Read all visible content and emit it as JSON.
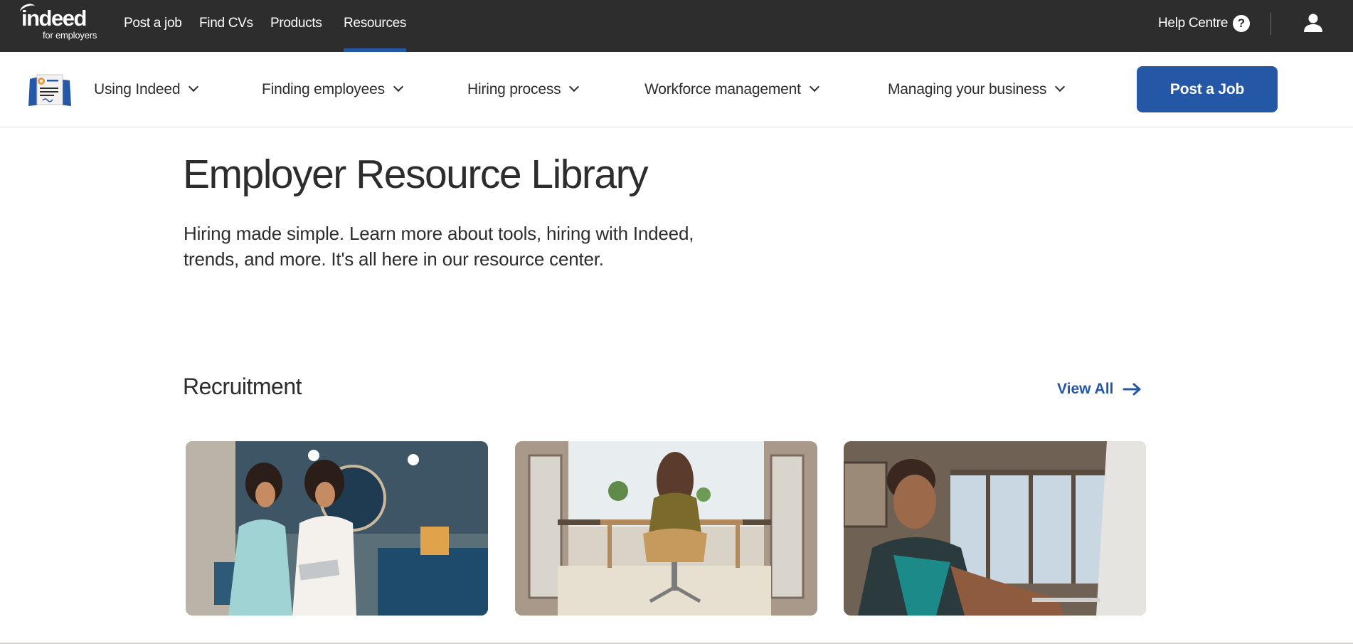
{
  "topbar": {
    "logo_word": "indeed",
    "logo_sub": "for employers",
    "nav": [
      "Post a job",
      "Find CVs",
      "Products",
      "Resources"
    ],
    "active_nav": "Resources",
    "help_label": "Help Centre",
    "help_icon": "question-icon",
    "user_icon": "person-icon"
  },
  "subnav": {
    "logo_icon": "document-illustration-icon",
    "items": [
      "Using Indeed",
      "Finding employees",
      "Hiring process",
      "Workforce management",
      "Managing your business"
    ],
    "cta_label": "Post a Job"
  },
  "main": {
    "title": "Employer Resource Library",
    "intro": "Hiring made simple. Learn more about tools, hiring with Indeed, trends, and more. It's all here in our resource center.",
    "section": {
      "title": "Recruitment",
      "view_all": "View All",
      "cards": [
        {
          "image": "two-women-looking-at-tablet-photo"
        },
        {
          "image": "woman-at-desk-by-window-photo"
        },
        {
          "image": "woman-typing-on-laptop-photo"
        }
      ]
    }
  },
  "colors": {
    "topbar_bg": "#2d2d2d",
    "brand_blue": "#2557a7",
    "text": "#2d2d2d"
  }
}
